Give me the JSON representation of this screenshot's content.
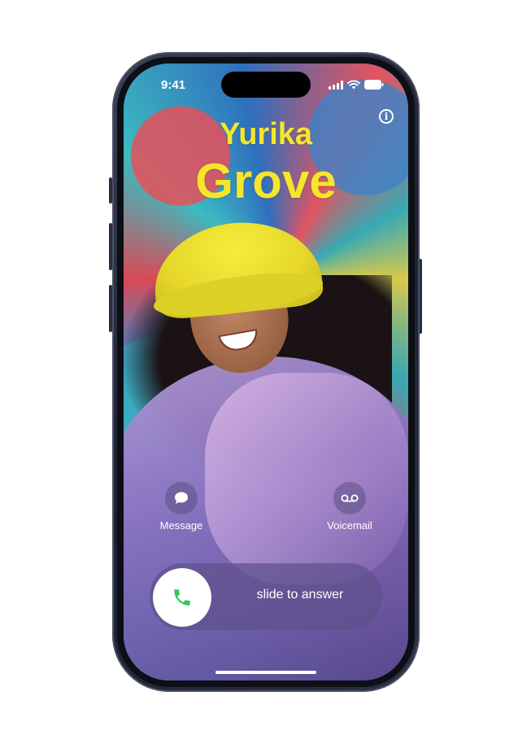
{
  "status_bar": {
    "time": "9:41",
    "icons": [
      "signal-icon",
      "wifi-icon",
      "battery-icon"
    ]
  },
  "contact": {
    "first_name": "Yurika",
    "last_name": "Grove",
    "name_color": "#f5e62a"
  },
  "actions": {
    "message_label": "Message",
    "message_icon": "message-bubble-icon",
    "voicemail_label": "Voicemail",
    "voicemail_icon": "voicemail-icon"
  },
  "answer_slider": {
    "label": "slide to answer",
    "knob_icon": "phone-icon",
    "knob_icon_color": "#34c759"
  },
  "info_button": {
    "icon": "info-icon",
    "glyph": "i"
  }
}
